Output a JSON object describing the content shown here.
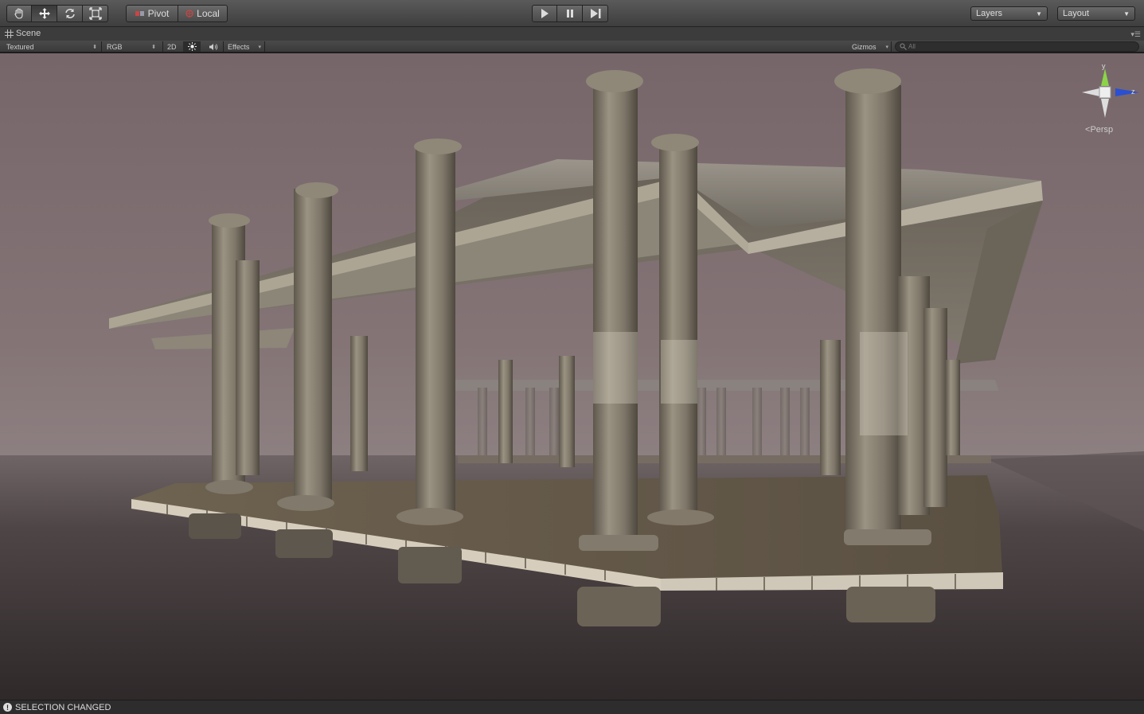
{
  "toolbar": {
    "tools": [
      {
        "name": "hand-tool",
        "icon": "hand-icon",
        "active": false
      },
      {
        "name": "move-tool",
        "icon": "move-arrows-icon",
        "active": true
      },
      {
        "name": "rotate-tool",
        "icon": "rotate-icon",
        "active": false
      },
      {
        "name": "scale-tool",
        "icon": "scale-icon",
        "active": false
      }
    ],
    "pivot_label": "Pivot",
    "local_label": "Local",
    "play_icon": "play-icon",
    "pause_icon": "pause-icon",
    "step_icon": "step-icon",
    "layers_label": "Layers",
    "layout_label": "Layout"
  },
  "scene_tab": {
    "label": "Scene",
    "icon": "grid-icon"
  },
  "scene_bar": {
    "draw_mode": "Textured",
    "render_mode": "RGB",
    "toggle_2d": "2D",
    "lighting_icon": "sun-icon",
    "audio_icon": "speaker-icon",
    "effects_label": "Effects",
    "gizmos_label": "Gizmos",
    "search_placeholder": "All"
  },
  "gizmo": {
    "y_label": "y",
    "z_label": "z",
    "projection": "Persp"
  },
  "status": {
    "message": "SELECTION CHANGED"
  },
  "colors": {
    "sky": "#7a6a6c",
    "water": "#3b3435",
    "stone": "#8f8878",
    "wood": "#6b5d4c"
  }
}
